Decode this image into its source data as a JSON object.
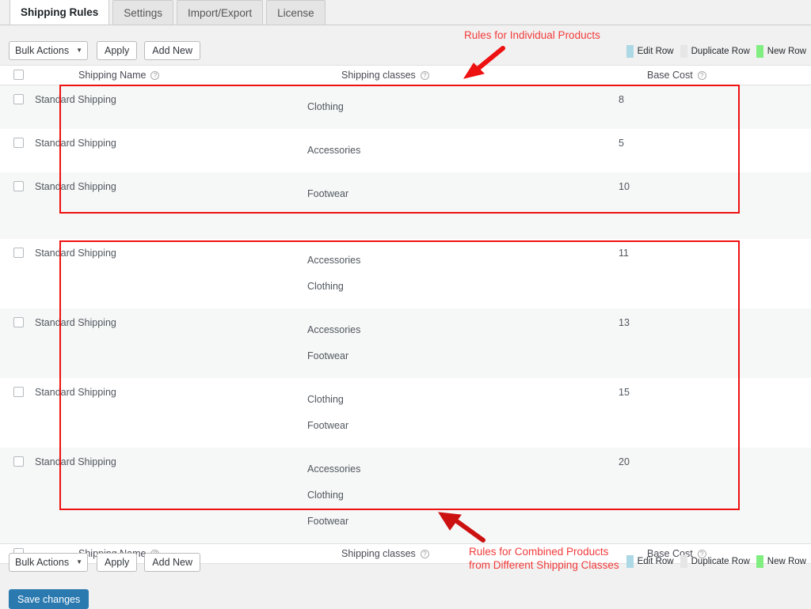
{
  "tabs": [
    {
      "label": "Shipping Rules",
      "active": true
    },
    {
      "label": "Settings",
      "active": false
    },
    {
      "label": "Import/Export",
      "active": false
    },
    {
      "label": "License",
      "active": false
    }
  ],
  "toolbar": {
    "bulk_actions_label": "Bulk Actions",
    "bulk_actions_caret": "▼",
    "apply_label": "Apply",
    "add_new_label": "Add New"
  },
  "legend": [
    {
      "label": "Edit Row",
      "color": "#add8e6"
    },
    {
      "label": "Duplicate Row",
      "color": "#e6e6e6"
    },
    {
      "label": "New Row",
      "color": "#81ee81"
    }
  ],
  "table": {
    "headers": {
      "shipping_name": "Shipping Name",
      "shipping_classes": "Shipping classes",
      "base_cost": "Base Cost",
      "help_icon": "?"
    },
    "rows": [
      {
        "name": "Standard Shipping",
        "classes": [
          "Clothing"
        ],
        "cost": "8"
      },
      {
        "name": "Standard Shipping",
        "classes": [
          "Accessories"
        ],
        "cost": "5"
      },
      {
        "name": "Standard Shipping",
        "classes": [
          "Footwear"
        ],
        "cost": "10"
      },
      {
        "name": "Standard Shipping",
        "classes": [
          "Accessories",
          "Clothing"
        ],
        "cost": "11"
      },
      {
        "name": "Standard Shipping",
        "classes": [
          "Accessories",
          "Footwear"
        ],
        "cost": "13"
      },
      {
        "name": "Standard Shipping",
        "classes": [
          "Clothing",
          "Footwear"
        ],
        "cost": "15"
      },
      {
        "name": "Standard Shipping",
        "classes": [
          "Accessories",
          "Clothing",
          "Footwear"
        ],
        "cost": "20"
      }
    ]
  },
  "footer": {
    "save_label": "Save changes"
  },
  "annotations": {
    "individual": "Rules for Individual Products",
    "combined": "Rules for Combined Products\nfrom Different Shipping Classes",
    "color": "#f23a3a"
  }
}
